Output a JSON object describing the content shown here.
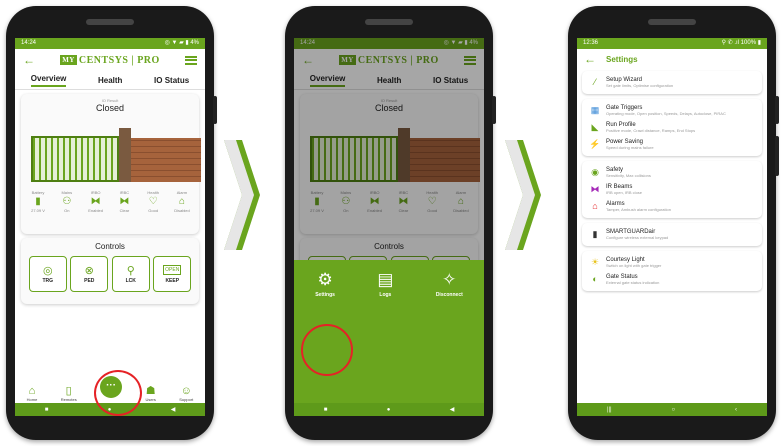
{
  "phone1": {
    "status": {
      "time": "14:24",
      "icons": "◎ ▼ ▰ ▮ 4%"
    },
    "tabs": [
      "Overview",
      "Health",
      "IO Status"
    ],
    "gate": {
      "small_label": "IO Result",
      "state": "Closed"
    },
    "status_items": [
      {
        "label": "Battery",
        "icon": "battery-icon",
        "glyph": "▮",
        "value": "27.09 V"
      },
      {
        "label": "Mains",
        "icon": "plug-icon",
        "glyph": "⚇",
        "value": "On"
      },
      {
        "label": "IRBO",
        "icon": "ir-beam-icon",
        "glyph": "⧓",
        "value": "Enabled"
      },
      {
        "label": "IRBC",
        "icon": "ir-beam-icon",
        "glyph": "⧓",
        "value": "Clear"
      },
      {
        "label": "Health",
        "icon": "heart-icon",
        "glyph": "♡",
        "value": "Good"
      },
      {
        "label": "Alarm",
        "icon": "alarm-icon",
        "glyph": "⌂",
        "value": "Disabled"
      }
    ],
    "controls_title": "Controls",
    "controls": [
      {
        "label": "TRG",
        "glyph": "◎"
      },
      {
        "label": "PED",
        "glyph": "⊗"
      },
      {
        "label": "LCK",
        "glyph": "⚲"
      },
      {
        "label": "KEEP",
        "glyph": "OPEN"
      }
    ],
    "bottom_nav": [
      {
        "label": "Home",
        "glyph": "⌂"
      },
      {
        "label": "Remotes",
        "glyph": "▯"
      },
      {
        "label": "",
        "glyph": "···"
      },
      {
        "label": "Users",
        "glyph": "☗"
      },
      {
        "label": "Support",
        "glyph": "☺"
      }
    ]
  },
  "phone2": {
    "sheet_items": [
      {
        "label": "Settings",
        "glyph": "⚙"
      },
      {
        "label": "Logs",
        "glyph": "▤"
      },
      {
        "label": "Disconnect",
        "glyph": "✧"
      }
    ]
  },
  "phone3": {
    "status": {
      "time": "12:36",
      "icons": "⚲ ✆ .ıl 100% ▮"
    },
    "title": "Settings",
    "groups": [
      [
        {
          "title": "Setup Wizard",
          "sub": "Set gate limits, Optimise configuration",
          "icon": "wand-icon",
          "glyph": "⁄",
          "color": "#6aa51e"
        }
      ],
      [
        {
          "title": "Gate Triggers",
          "sub": "Operating mode, Open position, Speeds, Delays, Autoclose, PIRAC",
          "icon": "trigger-icon",
          "glyph": "▦",
          "color": "#3a8ad6"
        },
        {
          "title": "Run Profile",
          "sub": "Positive mode, Crawl distance, Ramps, End Stops",
          "icon": "run-profile-icon",
          "glyph": "◣",
          "color": "#6aa51e"
        },
        {
          "title": "Power Saving",
          "sub": "Speed during mains failure",
          "icon": "power-icon",
          "glyph": "⚡",
          "color": "#a52ab8"
        }
      ],
      [
        {
          "title": "Safety",
          "sub": "Sensitivity, Max collisions",
          "icon": "shield-icon",
          "glyph": "◉",
          "color": "#6aa51e"
        },
        {
          "title": "IR Beams",
          "sub": "IRB open, IRB close",
          "icon": "ir-beam-icon",
          "glyph": "⧓",
          "color": "#a52ab8"
        },
        {
          "title": "Alarms",
          "sub": "Tamper, Ambush alarm configuration",
          "icon": "alarm-icon",
          "glyph": "⌂",
          "color": "#e52226"
        }
      ],
      [
        {
          "title": "SMARTGUARDair",
          "sub": "Configure wireless external keypad",
          "icon": "keypad-icon",
          "glyph": "▮",
          "color": "#333333"
        }
      ],
      [
        {
          "title": "Courtesy Light",
          "sub": "Switch on light with gate trigger",
          "icon": "light-icon",
          "glyph": "☀",
          "color": "#e8c21a"
        },
        {
          "title": "Gate Status",
          "sub": "External gate status indication",
          "icon": "status-icon",
          "glyph": "◐",
          "color": "#6aa51e"
        }
      ]
    ]
  },
  "brand": {
    "logo_box": "MY",
    "logo_text": "CENTSYS | PRO"
  },
  "colors": {
    "accent": "#6aa51e",
    "highlight": "#e52226"
  }
}
